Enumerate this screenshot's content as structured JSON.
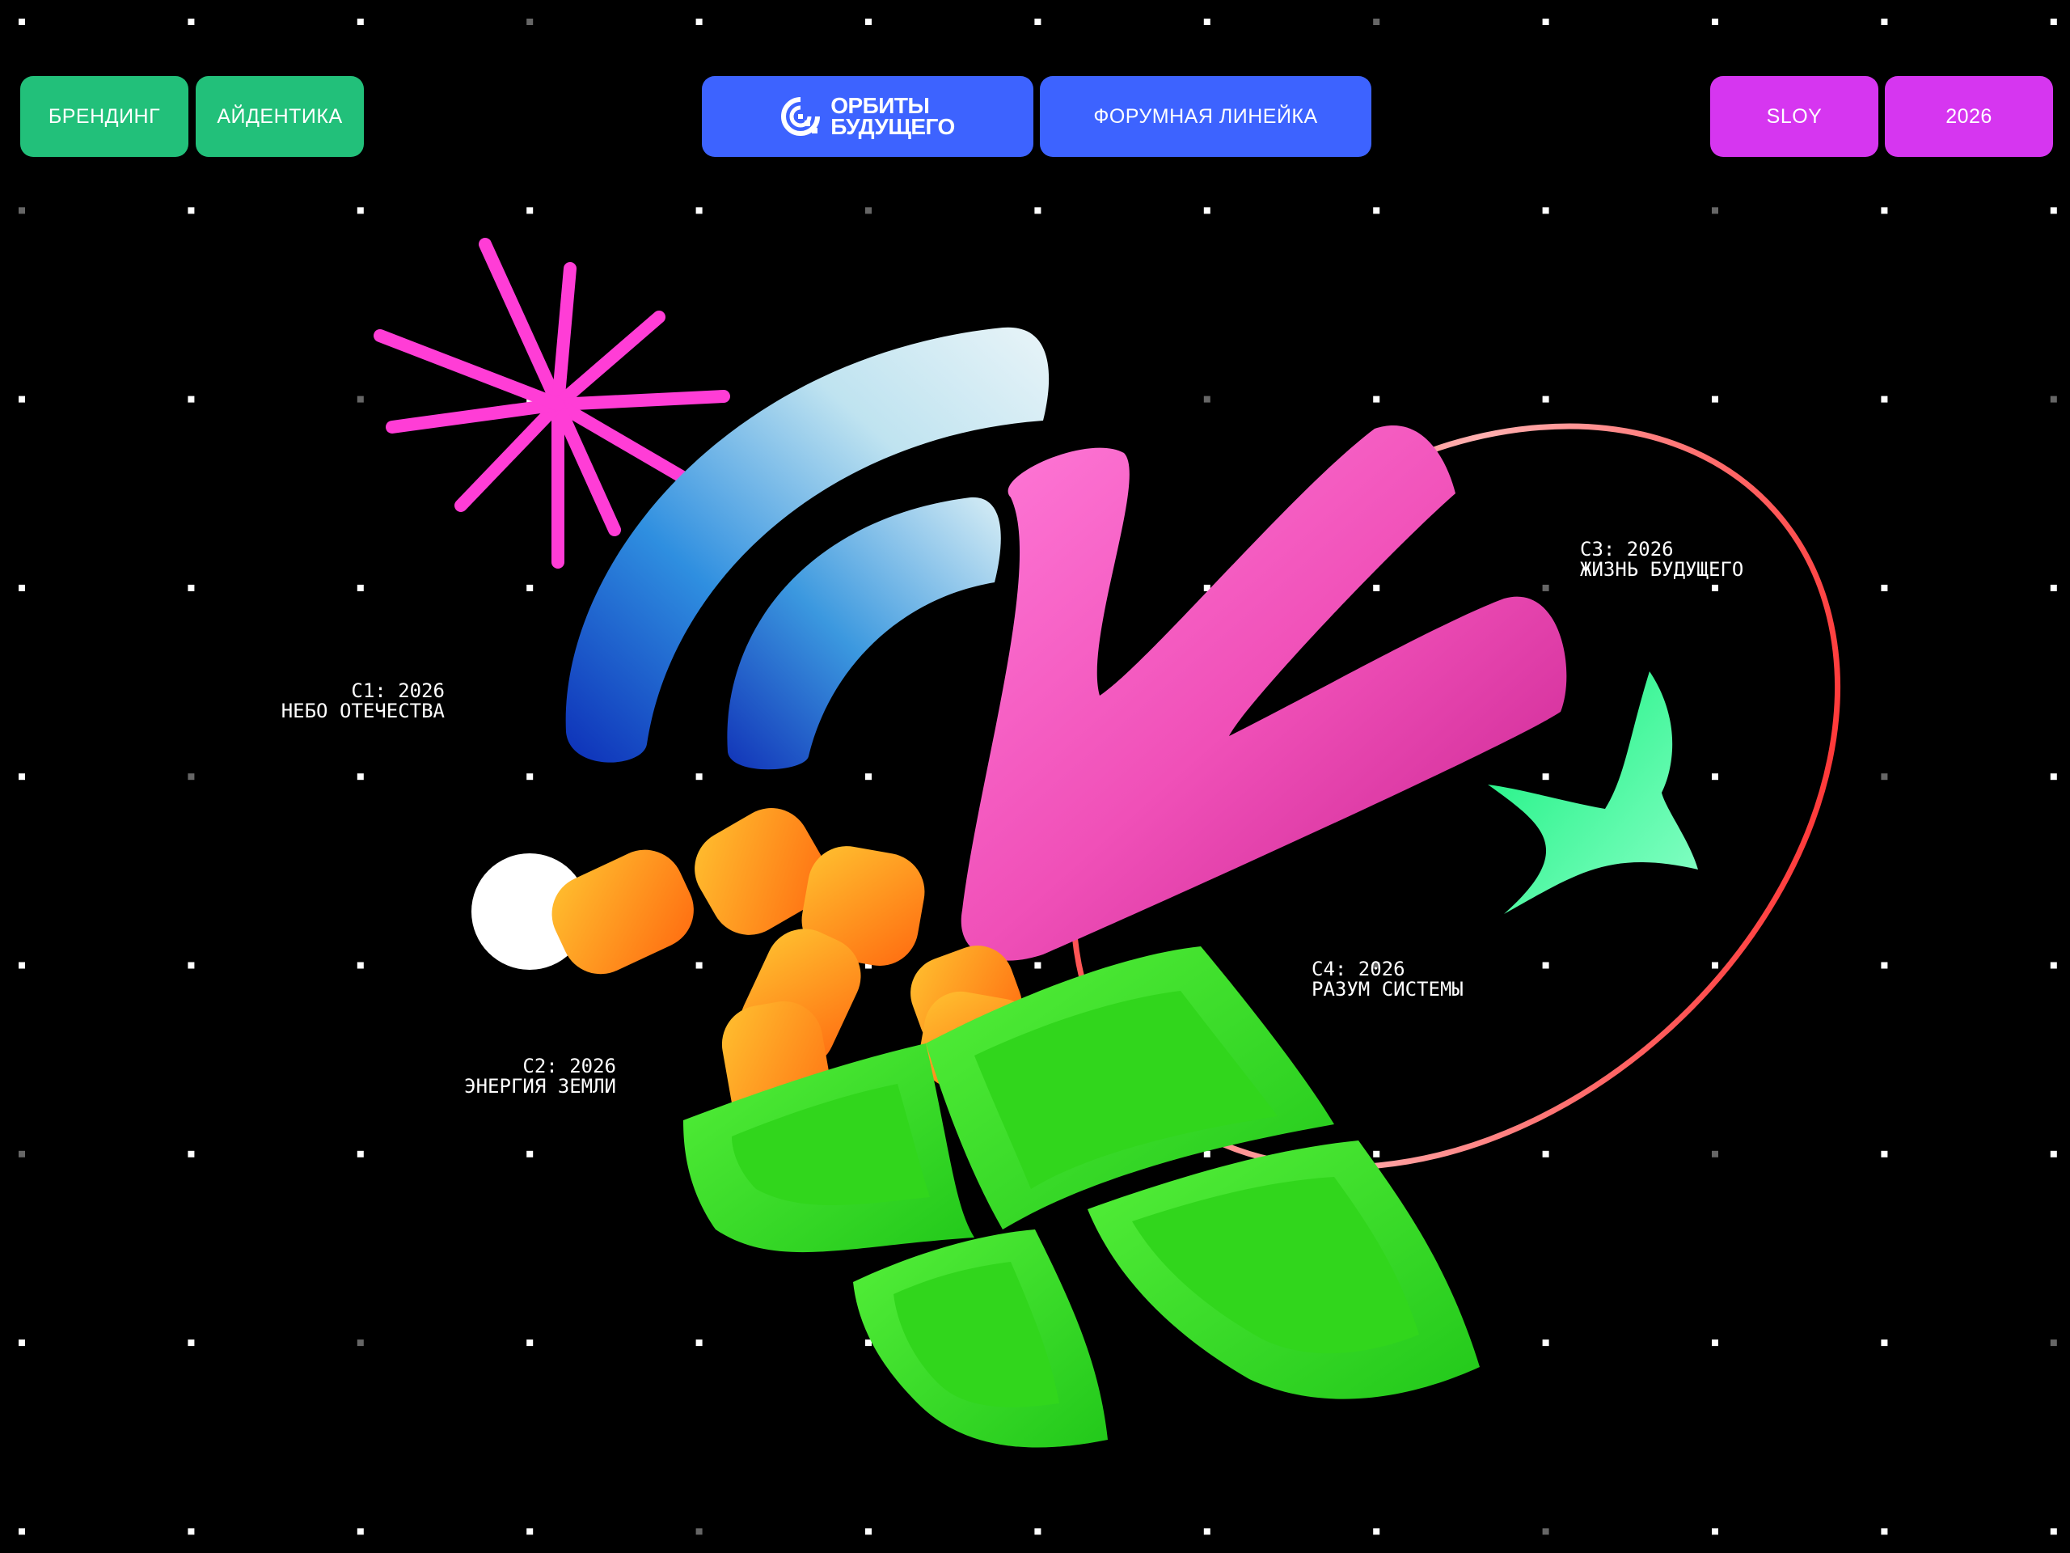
{
  "header": {
    "left_tags": [
      "БРЕНДИНГ",
      "АЙДЕНТИКА"
    ],
    "logo": {
      "line1": "ОРБИТЫ",
      "line2": "БУДУЩЕГО"
    },
    "center_tag": "ФОРУМНАЯ ЛИНЕЙКА",
    "right_tags": [
      "SLOY",
      "2026"
    ]
  },
  "labels": {
    "c1": {
      "code": "C1: 2026",
      "name": "НЕБО ОТЕЧЕСТВА"
    },
    "c2": {
      "code": "C2: 2026",
      "name": "ЭНЕРГИЯ ЗЕМЛИ"
    },
    "c3": {
      "code": "C3: 2026",
      "name": "ЖИЗНЬ БУДУЩЕГО"
    },
    "c4": {
      "code": "C4: 2026",
      "name": "РАЗУМ СИСТЕМЫ"
    }
  },
  "colors": {
    "background": "#000000",
    "green_tag": "#22c07a",
    "blue_tag": "#3d63ff",
    "magenta_tag": "#d636f0",
    "sparkle_pink": "#ff3dd6",
    "arc_blue": "#1f4fd8",
    "velvet_pink": "#ff4fc0",
    "velvet_green": "#3ce62d",
    "star_green": "#24ee8a",
    "orbit_red": "#ff1a1a",
    "jelly_orange": "#ff8a1a"
  },
  "icons": [
    "orbit-logo-icon",
    "sparkle-icon",
    "arc-icon",
    "velvet-v-icon",
    "four-point-star-icon",
    "orbit-ring-icon",
    "jelly-chain-icon",
    "white-dot-icon",
    "velvet-tiles-icon"
  ]
}
